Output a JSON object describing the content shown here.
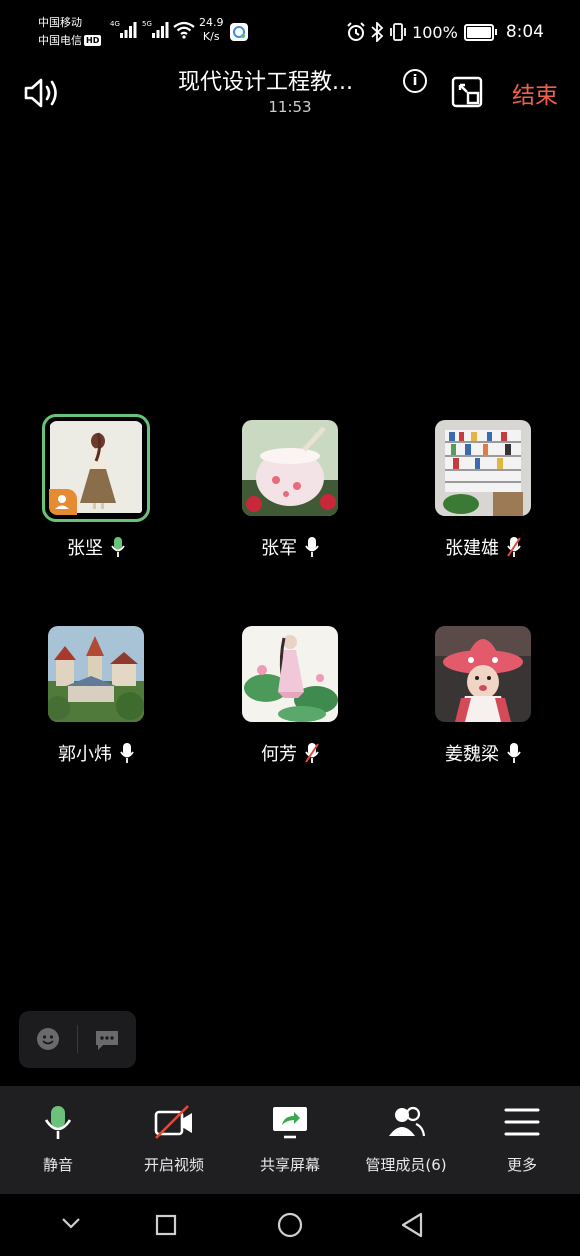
{
  "status_bar": {
    "carrier1": "中国移动",
    "carrier2": "中国电信",
    "hd": "HD",
    "net1": "4G",
    "net2": "5G",
    "speed_value": "24.9",
    "speed_unit": "K/s",
    "battery_pct": "100%",
    "time": "8:04"
  },
  "header": {
    "title": "现代设计工程教...",
    "timer": "11:53",
    "info_glyph": "i",
    "end_label": "结束"
  },
  "participants": [
    {
      "name": "张坚",
      "mic": "active",
      "avatar": "girl-drawing",
      "host": true,
      "speaking": true
    },
    {
      "name": "张军",
      "mic": "on",
      "avatar": "dessert-jar"
    },
    {
      "name": "张建雄",
      "mic": "muted",
      "avatar": "bookshelf"
    },
    {
      "name": "郭小炜",
      "mic": "on",
      "avatar": "castle-town"
    },
    {
      "name": "何芳",
      "mic": "muted",
      "avatar": "lotus-girl"
    },
    {
      "name": "姜魏梁",
      "mic": "on",
      "avatar": "child-hat"
    }
  ],
  "toolbar": {
    "mute_label": "静音",
    "video_label": "开启视频",
    "share_label": "共享屏幕",
    "members_label": "管理成员(6)",
    "more_label": "更多"
  },
  "colors": {
    "accent_green": "#6bc27a",
    "end_red": "#f0614b",
    "muted_red": "#e04a3c",
    "host_badge": "#e58c33"
  }
}
